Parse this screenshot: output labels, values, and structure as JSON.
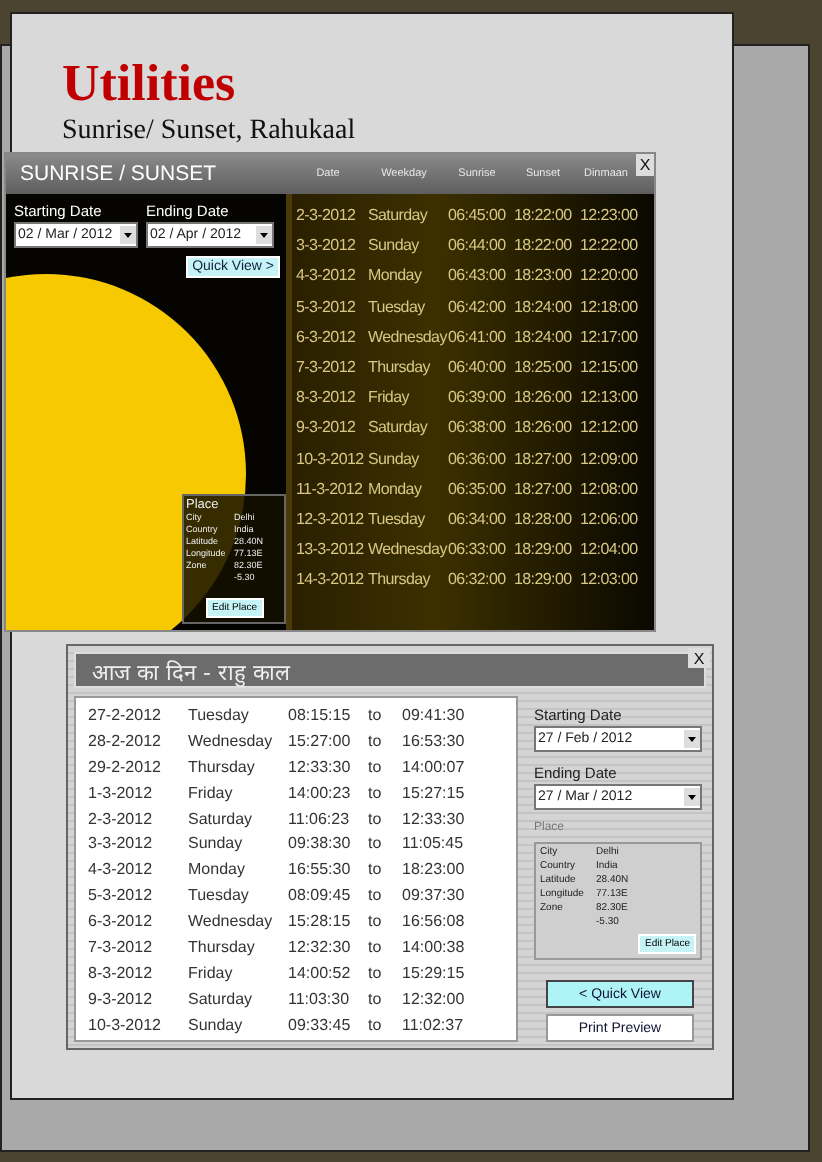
{
  "slide": {
    "title": "Utilities",
    "subtitle": "Sunrise/ Sunset, Rahukaal"
  },
  "sunrise_window": {
    "title": "SUNRISE / SUNSET",
    "close": "X",
    "starting_date": {
      "label": "Starting Date",
      "value": "02 / Mar / 2012"
    },
    "ending_date": {
      "label": "Ending Date",
      "value": "02 / Apr / 2012"
    },
    "quick_view": "Quick View >",
    "place": {
      "label": "Place",
      "fields": [
        {
          "label": "City",
          "value": [
            "Delhi"
          ]
        },
        {
          "label": "Country",
          "value": [
            "India"
          ]
        },
        {
          "label": "Latitude",
          "value": [
            "28.40N"
          ]
        },
        {
          "label": "Longitude",
          "value": [
            "77.13E"
          ]
        },
        {
          "label": "Zone",
          "value": [
            "82.30E",
            "-5.30"
          ]
        }
      ],
      "edit": "Edit Place"
    },
    "columns": [
      "Date",
      "Weekday",
      "Sunrise",
      "Sunset",
      "Dinmaan"
    ],
    "rows": [
      [
        "2-3-2012",
        "Saturday",
        "06:45:00",
        "18:22:00",
        "12:23:00"
      ],
      [
        "3-3-2012",
        "Sunday",
        "06:44:00",
        "18:22:00",
        "12:22:00"
      ],
      [
        "4-3-2012",
        "Monday",
        "06:43:00",
        "18:23:00",
        "12:20:00"
      ],
      [
        "5-3-2012",
        "Tuesday",
        "06:42:00",
        "18:24:00",
        "12:18:00"
      ],
      [
        "6-3-2012",
        "Wednesday",
        "06:41:00",
        "18:24:00",
        "12:17:00"
      ],
      [
        "7-3-2012",
        "Thursday",
        "06:40:00",
        "18:25:00",
        "12:15:00"
      ],
      [
        "8-3-2012",
        "Friday",
        "06:39:00",
        "18:26:00",
        "12:13:00"
      ],
      [
        "9-3-2012",
        "Saturday",
        "06:38:00",
        "18:26:00",
        "12:12:00"
      ],
      [
        "10-3-2012",
        "Sunday",
        "06:36:00",
        "18:27:00",
        "12:09:00"
      ],
      [
        "11-3-2012",
        "Monday",
        "06:35:00",
        "18:27:00",
        "12:08:00"
      ],
      [
        "12-3-2012",
        "Tuesday",
        "06:34:00",
        "18:28:00",
        "12:06:00"
      ],
      [
        "13-3-2012",
        "Wednesday",
        "06:33:00",
        "18:29:00",
        "12:04:00"
      ],
      [
        "14-3-2012",
        "Thursday",
        "06:32:00",
        "18:29:00",
        "12:03:00"
      ]
    ]
  },
  "rahukaal_window": {
    "title": "आज का दिन - राहु काल",
    "close": "X",
    "rows": [
      [
        "27-2-2012",
        "Tuesday",
        "08:15:15",
        "to",
        "09:41:30"
      ],
      [
        "28-2-2012",
        "Wednesday",
        "15:27:00",
        "to",
        "16:53:30"
      ],
      [
        "29-2-2012",
        "Thursday",
        "12:33:30",
        "to",
        "14:00:07"
      ],
      [
        "1-3-2012",
        "Friday",
        "14:00:23",
        "to",
        "15:27:15"
      ],
      [
        "2-3-2012",
        "Saturday",
        "11:06:23",
        "to",
        "12:33:30"
      ],
      [
        "3-3-2012",
        "Sunday",
        "09:38:30",
        "to",
        "11:05:45"
      ],
      [
        "4-3-2012",
        "Monday",
        "16:55:30",
        "to",
        "18:23:00"
      ],
      [
        "5-3-2012",
        "Tuesday",
        "08:09:45",
        "to",
        "09:37:30"
      ],
      [
        "6-3-2012",
        "Wednesday",
        "15:28:15",
        "to",
        "16:56:08"
      ],
      [
        "7-3-2012",
        "Thursday",
        "12:32:30",
        "to",
        "14:00:38"
      ],
      [
        "8-3-2012",
        "Friday",
        "14:00:52",
        "to",
        "15:29:15"
      ],
      [
        "9-3-2012",
        "Saturday",
        "11:03:30",
        "to",
        "12:32:00"
      ],
      [
        "10-3-2012",
        "Sunday",
        "09:33:45",
        "to",
        "11:02:37"
      ]
    ],
    "starting_date": {
      "label": "Starting Date",
      "value": "27 / Feb / 2012"
    },
    "ending_date": {
      "label": "Ending Date",
      "value": "27 / Mar / 2012"
    },
    "place": {
      "label": "Place",
      "fields": [
        {
          "label": "City",
          "value": [
            "Delhi"
          ]
        },
        {
          "label": "Country",
          "value": [
            "India"
          ]
        },
        {
          "label": "Latitude",
          "value": [
            "28.40N"
          ]
        },
        {
          "label": "Longitude",
          "value": [
            "77.13E"
          ]
        },
        {
          "label": "Zone",
          "value": [
            "82.30E",
            "-5.30"
          ]
        }
      ],
      "edit": "Edit Place"
    },
    "quick_view": "< Quick View",
    "print_preview": "Print Preview"
  }
}
